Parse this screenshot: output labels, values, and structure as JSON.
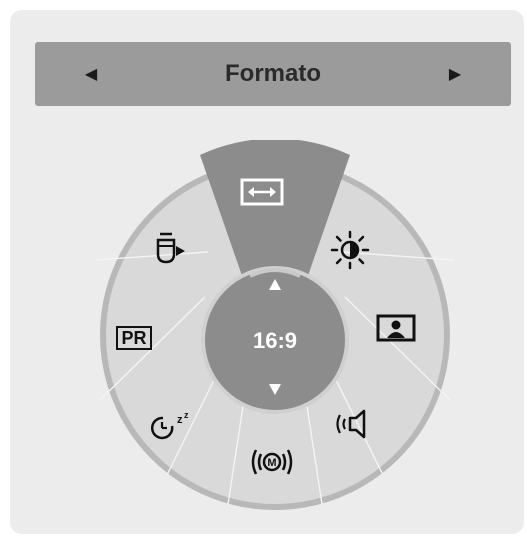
{
  "header": {
    "title": "Formato",
    "prev_icon": "left-triangle-icon",
    "next_icon": "right-triangle-icon"
  },
  "dial": {
    "selected_value": "16:9",
    "selected_segment": "aspect-ratio",
    "segments": [
      {
        "name": "aspect-ratio",
        "icon": "aspect-ratio-icon"
      },
      {
        "name": "picture-mode",
        "icon": "brightness-contrast-icon"
      },
      {
        "name": "picture-size",
        "icon": "person-portrait-icon"
      },
      {
        "name": "sound-mode",
        "icon": "speaker-icon"
      },
      {
        "name": "mts",
        "icon": "mts-audio-icon"
      },
      {
        "name": "sleep-timer",
        "icon": "sleep-timer-icon"
      },
      {
        "name": "program-list",
        "icon": "program-list-icon",
        "label": "PR"
      },
      {
        "name": "input-source",
        "icon": "input-source-icon"
      }
    ]
  },
  "colors": {
    "panel": "#ececec",
    "header": "#9b9b9b",
    "dial": "#d9d9d9",
    "dial_border": "#b5b5b5",
    "selected": "#8c8c8c",
    "center": "#8c8c8c",
    "icon": "#111111"
  }
}
